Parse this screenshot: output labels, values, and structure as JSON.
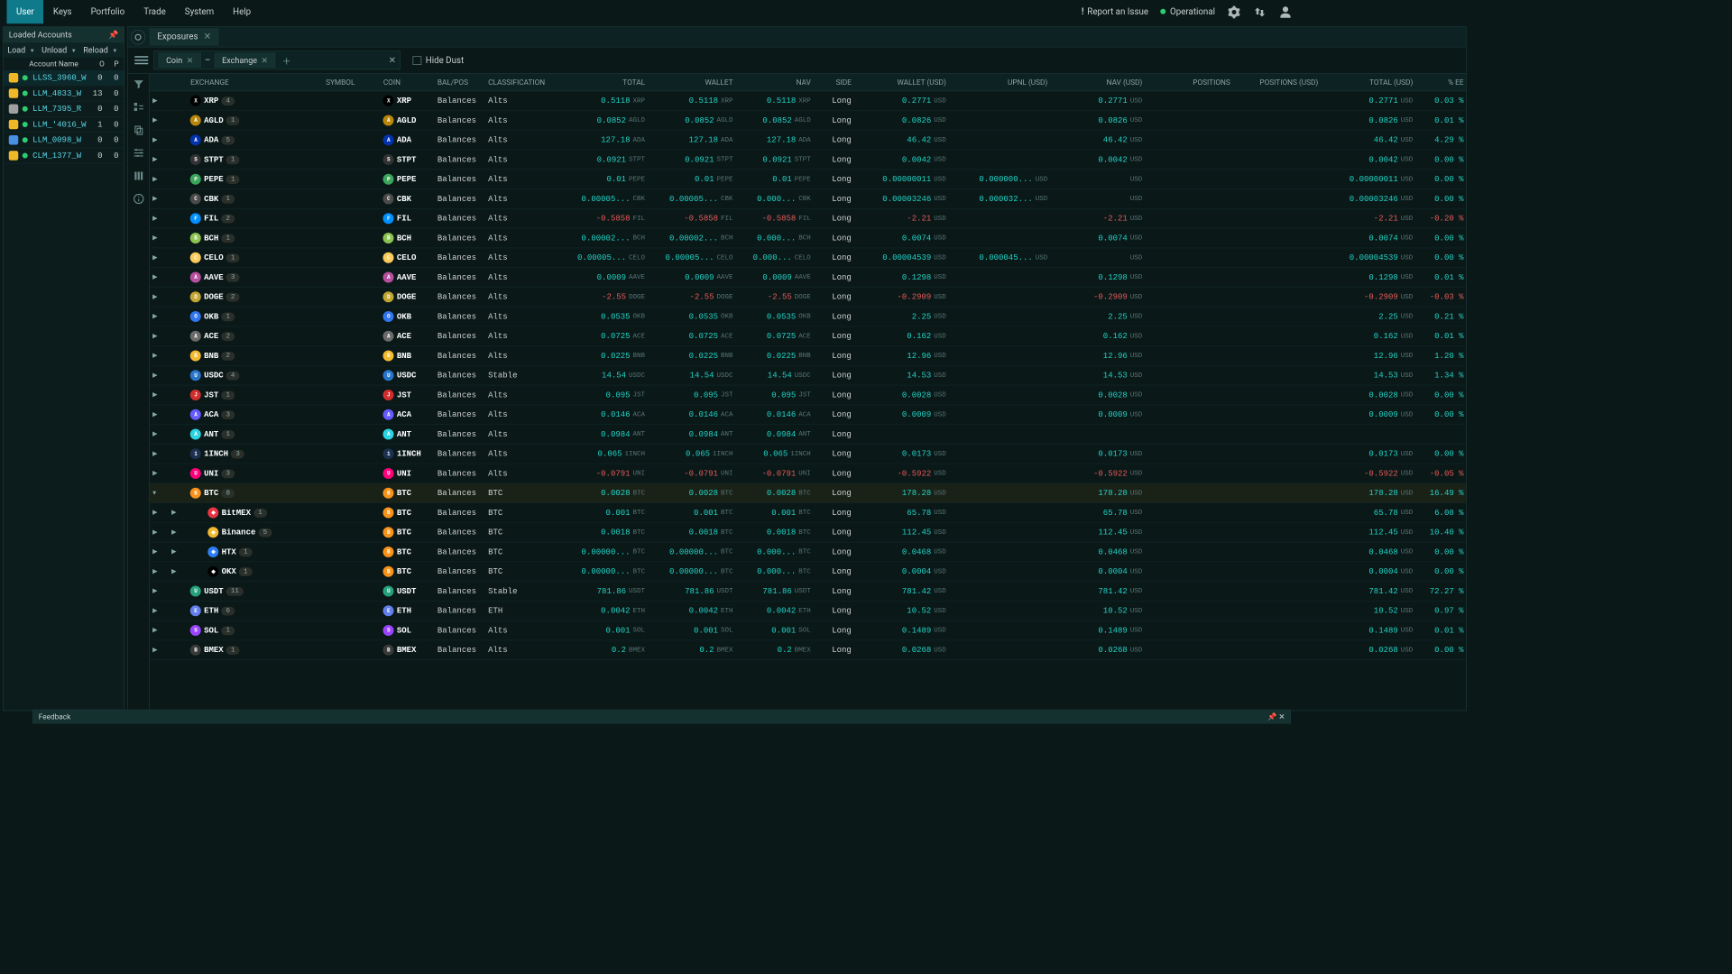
{
  "menu": [
    "User",
    "Keys",
    "Portfolio",
    "Trade",
    "System",
    "Help"
  ],
  "menu_active": 0,
  "header_right": {
    "report": "Report an Issue",
    "status": "Operational"
  },
  "sidebar": {
    "title": "Loaded Accounts",
    "buttons": [
      "Load",
      "Unload",
      "Reload"
    ],
    "columns": {
      "name": "Account Name",
      "o": "O",
      "p": "P"
    },
    "accounts": [
      {
        "name": "LLSS_3960_W",
        "o": 0,
        "p": 0,
        "active": true,
        "color": "#f0b829"
      },
      {
        "name": "LLM_4833_W",
        "o": 13,
        "p": 0,
        "color": "#f0b829"
      },
      {
        "name": "LLM_7395_R",
        "o": 0,
        "p": 0,
        "color": "#a0a0a0"
      },
      {
        "name": "LLM_'4016_W",
        "o": 1,
        "p": 0,
        "color": "#f0b829"
      },
      {
        "name": "LLM_0098_W",
        "o": 0,
        "p": 0,
        "color": "#4a90e2"
      },
      {
        "name": "CLM_1377_W",
        "o": 0,
        "p": 0,
        "color": "#f0b829"
      }
    ]
  },
  "tab": {
    "name": "Exposures"
  },
  "filter": {
    "chips": [
      "Coin",
      "Exchange"
    ],
    "hide_dust": "Hide Dust"
  },
  "columns": [
    "",
    "",
    "EXCHANGE",
    "SYMBOL",
    "COIN",
    "BAL/POS",
    "CLASSIFICATION",
    "TOTAL",
    "WALLET",
    "NAV",
    "SIDE",
    "WALLET (USD)",
    "UPNL (USD)",
    "NAV (USD)",
    "POSITIONS",
    "POSITIONS (USD)",
    "TOTAL (USD)",
    "% EE"
  ],
  "rows": [
    {
      "sym": "XRP",
      "badge": 4,
      "ic": "#000",
      "coin": "XRP",
      "bp": "Balances",
      "cls": "Alts",
      "total": "0.5118",
      "tu": "XRP",
      "wallet": "0.5118",
      "wu": "XRP",
      "nav": "0.5118",
      "nu": "XRP",
      "side": "Long",
      "wusd": "0.2771",
      "uu": "USD",
      "upnl": "",
      "navusd": "0.2771",
      "nuu": "USD",
      "pos": "",
      "posusd": "",
      "tusd": "0.2771",
      "tuu": "USD",
      "ee": "0.03 %"
    },
    {
      "sym": "AGLD",
      "badge": 1,
      "ic": "#b8860b",
      "coin": "AGLD",
      "bp": "Balances",
      "cls": "Alts",
      "total": "0.0852",
      "tu": "AGLD",
      "wallet": "0.0852",
      "wu": "AGLD",
      "nav": "0.0852",
      "nu": "AGLD",
      "side": "Long",
      "wusd": "0.0826",
      "uu": "USD",
      "upnl": "",
      "navusd": "0.0826",
      "nuu": "USD",
      "pos": "",
      "posusd": "",
      "tusd": "0.0826",
      "tuu": "USD",
      "ee": "0.01 %"
    },
    {
      "sym": "ADA",
      "badge": 5,
      "ic": "#0033ad",
      "coin": "ADA",
      "bp": "Balances",
      "cls": "Alts",
      "total": "127.18",
      "tu": "ADA",
      "wallet": "127.18",
      "wu": "ADA",
      "nav": "127.18",
      "nu": "ADA",
      "side": "Long",
      "wusd": "46.42",
      "uu": "USD",
      "upnl": "",
      "navusd": "46.42",
      "nuu": "USD",
      "pos": "",
      "posusd": "",
      "tusd": "46.42",
      "tuu": "USD",
      "ee": "4.29 %"
    },
    {
      "sym": "STPT",
      "badge": 1,
      "ic": "#333",
      "coin": "STPT",
      "bp": "Balances",
      "cls": "Alts",
      "total": "0.0921",
      "tu": "STPT",
      "wallet": "0.0921",
      "wu": "STPT",
      "nav": "0.0921",
      "nu": "STPT",
      "side": "Long",
      "wusd": "0.0042",
      "uu": "USD",
      "upnl": "",
      "navusd": "0.0042",
      "nuu": "USD",
      "pos": "",
      "posusd": "",
      "tusd": "0.0042",
      "tuu": "USD",
      "ee": "0.00 %"
    },
    {
      "sym": "PEPE",
      "badge": 1,
      "ic": "#3ba55c",
      "coin": "PEPE",
      "bp": "Balances",
      "cls": "Alts",
      "total": "0.01",
      "tu": "PEPE",
      "wallet": "0.01",
      "wu": "PEPE",
      "nav": "0.01",
      "nu": "PEPE",
      "side": "Long",
      "wusd": "0.00000011",
      "uu": "USD",
      "upnl": "0.000000...",
      "navusd": "",
      "nuu": "USD",
      "pos": "",
      "posusd": "",
      "tusd": "0.00000011",
      "tuu": "USD",
      "ee": "0.00 %"
    },
    {
      "sym": "CBK",
      "badge": 1,
      "ic": "#4a4a4a",
      "coin": "CBK",
      "bp": "Balances",
      "cls": "Alts",
      "total": "0.00005...",
      "tu": "CBK",
      "wallet": "0.00005...",
      "wu": "CBK",
      "nav": "0.000...",
      "nu": "CBK",
      "side": "Long",
      "wusd": "0.00003246",
      "uu": "USD",
      "upnl": "0.000032...",
      "navusd": "",
      "nuu": "USD",
      "pos": "",
      "posusd": "",
      "tusd": "0.00003246",
      "tuu": "USD",
      "ee": "0.00 %"
    },
    {
      "sym": "FIL",
      "badge": 2,
      "ic": "#0090ff",
      "coin": "FIL",
      "bp": "Balances",
      "cls": "Alts",
      "total": "-0.5858",
      "tneg": true,
      "tu": "FIL",
      "wallet": "-0.5858",
      "wneg": true,
      "wu": "FIL",
      "nav": "-0.5858",
      "nneg": true,
      "nu": "FIL",
      "side": "Long",
      "wusd": "-2.21",
      "wuneg": true,
      "uu": "USD",
      "upnl": "",
      "navusd": "-2.21",
      "nvneg": true,
      "nuu": "USD",
      "pos": "",
      "posusd": "",
      "tusd": "-2.21",
      "tuneg": true,
      "tuu": "USD",
      "ee": "-0.20 %",
      "eeneg": true
    },
    {
      "sym": "BCH",
      "badge": 1,
      "ic": "#8dc351",
      "coin": "BCH",
      "bp": "Balances",
      "cls": "Alts",
      "total": "0.00002...",
      "tu": "BCH",
      "wallet": "0.00002...",
      "wu": "BCH",
      "nav": "0.000...",
      "nu": "BCH",
      "side": "Long",
      "wusd": "0.0074",
      "uu": "USD",
      "upnl": "",
      "navusd": "0.0074",
      "nuu": "USD",
      "pos": "",
      "posusd": "",
      "tusd": "0.0074",
      "tuu": "USD",
      "ee": "0.00 %"
    },
    {
      "sym": "CELO",
      "badge": 1,
      "ic": "#fbcc5c",
      "coin": "CELO",
      "bp": "Balances",
      "cls": "Alts",
      "total": "0.00005...",
      "tu": "CELO",
      "wallet": "0.00005...",
      "wu": "CELO",
      "nav": "0.000...",
      "nu": "CELO",
      "side": "Long",
      "wusd": "0.00004539",
      "uu": "USD",
      "upnl": "0.000045...",
      "navusd": "",
      "nuu": "USD",
      "pos": "",
      "posusd": "",
      "tusd": "0.00004539",
      "tuu": "USD",
      "ee": "0.00 %"
    },
    {
      "sym": "AAVE",
      "badge": 3,
      "ic": "#b6509e",
      "coin": "AAVE",
      "bp": "Balances",
      "cls": "Alts",
      "total": "0.0009",
      "tu": "AAVE",
      "wallet": "0.0009",
      "wu": "AAVE",
      "nav": "0.0009",
      "nu": "AAVE",
      "side": "Long",
      "wusd": "0.1298",
      "uu": "USD",
      "upnl": "",
      "navusd": "0.1298",
      "nuu": "USD",
      "pos": "",
      "posusd": "",
      "tusd": "0.1298",
      "tuu": "USD",
      "ee": "0.01 %"
    },
    {
      "sym": "DOGE",
      "badge": 2,
      "ic": "#c2a633",
      "coin": "DOGE",
      "bp": "Balances",
      "cls": "Alts",
      "total": "-2.55",
      "tneg": true,
      "tu": "DOGE",
      "wallet": "-2.55",
      "wneg": true,
      "wu": "DOGE",
      "nav": "-2.55",
      "nneg": true,
      "nu": "DOGE",
      "side": "Long",
      "wusd": "-0.2909",
      "wuneg": true,
      "uu": "USD",
      "upnl": "",
      "navusd": "-0.2909",
      "nvneg": true,
      "nuu": "USD",
      "pos": "",
      "posusd": "",
      "tusd": "-0.2909",
      "tuneg": true,
      "tuu": "USD",
      "ee": "-0.03 %",
      "eeneg": true
    },
    {
      "sym": "OKB",
      "badge": 1,
      "ic": "#3075ee",
      "coin": "OKB",
      "bp": "Balances",
      "cls": "Alts",
      "total": "0.0535",
      "tu": "OKB",
      "wallet": "0.0535",
      "wu": "OKB",
      "nav": "0.0535",
      "nu": "OKB",
      "side": "Long",
      "wusd": "2.25",
      "uu": "USD",
      "upnl": "",
      "navusd": "2.25",
      "nuu": "USD",
      "pos": "",
      "posusd": "",
      "tusd": "2.25",
      "tuu": "USD",
      "ee": "0.21 %"
    },
    {
      "sym": "ACE",
      "badge": 2,
      "ic": "#6a6a6a",
      "coin": "ACE",
      "bp": "Balances",
      "cls": "Alts",
      "total": "0.0725",
      "tu": "ACE",
      "wallet": "0.0725",
      "wu": "ACE",
      "nav": "0.0725",
      "nu": "ACE",
      "side": "Long",
      "wusd": "0.162",
      "uu": "USD",
      "upnl": "",
      "navusd": "0.162",
      "nuu": "USD",
      "pos": "",
      "posusd": "",
      "tusd": "0.162",
      "tuu": "USD",
      "ee": "0.01 %"
    },
    {
      "sym": "BNB",
      "badge": 2,
      "ic": "#f3ba2f",
      "coin": "BNB",
      "bp": "Balances",
      "cls": "Alts",
      "total": "0.0225",
      "tu": "BNB",
      "wallet": "0.0225",
      "wu": "BNB",
      "nav": "0.0225",
      "nu": "BNB",
      "side": "Long",
      "wusd": "12.96",
      "uu": "USD",
      "upnl": "",
      "navusd": "12.96",
      "nuu": "USD",
      "pos": "",
      "posusd": "",
      "tusd": "12.96",
      "tuu": "USD",
      "ee": "1.20 %"
    },
    {
      "sym": "USDC",
      "badge": 4,
      "ic": "#2775ca",
      "coin": "USDC",
      "bp": "Balances",
      "cls": "Stable",
      "total": "14.54",
      "tu": "USDC",
      "wallet": "14.54",
      "wu": "USDC",
      "nav": "14.54",
      "nu": "USDC",
      "side": "Long",
      "wusd": "14.53",
      "uu": "USD",
      "upnl": "",
      "navusd": "14.53",
      "nuu": "USD",
      "pos": "",
      "posusd": "",
      "tusd": "14.53",
      "tuu": "USD",
      "ee": "1.34 %"
    },
    {
      "sym": "JST",
      "badge": 1,
      "ic": "#d12e2e",
      "coin": "JST",
      "bp": "Balances",
      "cls": "Alts",
      "total": "0.095",
      "tu": "JST",
      "wallet": "0.095",
      "wu": "JST",
      "nav": "0.095",
      "nu": "JST",
      "side": "Long",
      "wusd": "0.0028",
      "uu": "USD",
      "upnl": "",
      "navusd": "0.0028",
      "nuu": "USD",
      "pos": "",
      "posusd": "",
      "tusd": "0.0028",
      "tuu": "USD",
      "ee": "0.00 %"
    },
    {
      "sym": "ACA",
      "badge": 3,
      "ic": "#645aff",
      "coin": "ACA",
      "bp": "Balances",
      "cls": "Alts",
      "total": "0.0146",
      "tu": "ACA",
      "wallet": "0.0146",
      "wu": "ACA",
      "nav": "0.0146",
      "nu": "ACA",
      "side": "Long",
      "wusd": "0.0009",
      "uu": "USD",
      "upnl": "",
      "navusd": "0.0009",
      "nuu": "USD",
      "pos": "",
      "posusd": "",
      "tusd": "0.0009",
      "tuu": "USD",
      "ee": "0.00 %"
    },
    {
      "sym": "ANT",
      "badge": 1,
      "ic": "#2cd3e1",
      "coin": "ANT",
      "bp": "Balances",
      "cls": "Alts",
      "total": "0.0984",
      "tu": "ANT",
      "wallet": "0.0984",
      "wu": "ANT",
      "nav": "0.0984",
      "nu": "ANT",
      "side": "Long",
      "wusd": "",
      "uu": "",
      "upnl": "",
      "navusd": "",
      "nuu": "",
      "pos": "",
      "posusd": "",
      "tusd": "",
      "tuu": "",
      "ee": ""
    },
    {
      "sym": "1INCH",
      "badge": 3,
      "ic": "#1b314f",
      "coin": "1INCH",
      "bp": "Balances",
      "cls": "Alts",
      "total": "0.065",
      "tu": "1INCH",
      "wallet": "0.065",
      "wu": "1INCH",
      "nav": "0.065",
      "nu": "1INCH",
      "side": "Long",
      "wusd": "0.0173",
      "uu": "USD",
      "upnl": "",
      "navusd": "0.0173",
      "nuu": "USD",
      "pos": "",
      "posusd": "",
      "tusd": "0.0173",
      "tuu": "USD",
      "ee": "0.00 %"
    },
    {
      "sym": "UNI",
      "badge": 3,
      "ic": "#ff007a",
      "coin": "UNI",
      "bp": "Balances",
      "cls": "Alts",
      "total": "-0.0791",
      "tneg": true,
      "tu": "UNI",
      "wallet": "-0.0791",
      "wneg": true,
      "wu": "UNI",
      "nav": "-0.0791",
      "nneg": true,
      "nu": "UNI",
      "side": "Long",
      "wusd": "-0.5922",
      "wuneg": true,
      "uu": "USD",
      "upnl": "",
      "navusd": "-0.5922",
      "nvneg": true,
      "nuu": "USD",
      "pos": "",
      "posusd": "",
      "tusd": "-0.5922",
      "tuneg": true,
      "tuu": "USD",
      "ee": "-0.05 %",
      "eeneg": true
    },
    {
      "sym": "BTC",
      "badge": 8,
      "ic": "#f7931a",
      "coin": "BTC",
      "bp": "Balances",
      "cls": "BTC",
      "total": "0.0028",
      "tu": "BTC",
      "wallet": "0.0028",
      "wu": "BTC",
      "nav": "0.0028",
      "nu": "BTC",
      "side": "Long",
      "wusd": "178.28",
      "uu": "USD",
      "upnl": "",
      "navusd": "178.28",
      "nuu": "USD",
      "pos": "",
      "posusd": "",
      "tusd": "178.28",
      "tuu": "USD",
      "ee": "16.49 %",
      "expanded": true
    },
    {
      "sub": true,
      "exch": "BitMEX",
      "exic": "#e83544",
      "badge": 1,
      "ic": "#f7931a",
      "coin": "BTC",
      "bp": "Balances",
      "cls": "BTC",
      "total": "0.001",
      "tu": "BTC",
      "wallet": "0.001",
      "wu": "BTC",
      "nav": "0.001",
      "nu": "BTC",
      "side": "Long",
      "wusd": "65.78",
      "uu": "USD",
      "upnl": "",
      "navusd": "65.78",
      "nuu": "USD",
      "pos": "",
      "posusd": "",
      "tusd": "65.78",
      "tuu": "USD",
      "ee": "6.08 %"
    },
    {
      "sub": true,
      "exch": "Binance",
      "exic": "#f3ba2f",
      "badge": 5,
      "ic": "#f7931a",
      "coin": "BTC",
      "bp": "Balances",
      "cls": "BTC",
      "total": "0.0018",
      "tu": "BTC",
      "wallet": "0.0018",
      "wu": "BTC",
      "nav": "0.0018",
      "nu": "BTC",
      "side": "Long",
      "wusd": "112.45",
      "uu": "USD",
      "upnl": "",
      "navusd": "112.45",
      "nuu": "USD",
      "pos": "",
      "posusd": "",
      "tusd": "112.45",
      "tuu": "USD",
      "ee": "10.40 %"
    },
    {
      "sub": true,
      "exch": "HTX",
      "exic": "#2e7df6",
      "badge": 1,
      "ic": "#f7931a",
      "coin": "BTC",
      "bp": "Balances",
      "cls": "BTC",
      "total": "0.00000...",
      "tu": "BTC",
      "wallet": "0.00000...",
      "wu": "BTC",
      "nav": "0.000...",
      "nu": "BTC",
      "side": "Long",
      "wusd": "0.0468",
      "uu": "USD",
      "upnl": "",
      "navusd": "0.0468",
      "nuu": "USD",
      "pos": "",
      "posusd": "",
      "tusd": "0.0468",
      "tuu": "USD",
      "ee": "0.00 %"
    },
    {
      "sub": true,
      "exch": "OKX",
      "exic": "#000",
      "badge": 1,
      "ic": "#f7931a",
      "coin": "BTC",
      "bp": "Balances",
      "cls": "BTC",
      "total": "0.00000...",
      "tu": "BTC",
      "wallet": "0.00000...",
      "wu": "BTC",
      "nav": "0.000...",
      "nu": "BTC",
      "side": "Long",
      "wusd": "0.0004",
      "uu": "USD",
      "upnl": "",
      "navusd": "0.0004",
      "nuu": "USD",
      "pos": "",
      "posusd": "",
      "tusd": "0.0004",
      "tuu": "USD",
      "ee": "0.00 %"
    },
    {
      "sym": "USDT",
      "badge": 11,
      "ic": "#26a17b",
      "coin": "USDT",
      "bp": "Balances",
      "cls": "Stable",
      "total": "781.86",
      "tu": "USDT",
      "wallet": "781.86",
      "wu": "USDT",
      "nav": "781.86",
      "nu": "USDT",
      "side": "Long",
      "wusd": "781.42",
      "uu": "USD",
      "upnl": "",
      "navusd": "781.42",
      "nuu": "USD",
      "pos": "",
      "posusd": "",
      "tusd": "781.42",
      "tuu": "USD",
      "ee": "72.27 %"
    },
    {
      "sym": "ETH",
      "badge": 6,
      "ic": "#627eea",
      "coin": "ETH",
      "bp": "Balances",
      "cls": "ETH",
      "total": "0.0042",
      "tu": "ETH",
      "wallet": "0.0042",
      "wu": "ETH",
      "nav": "0.0042",
      "nu": "ETH",
      "side": "Long",
      "wusd": "10.52",
      "uu": "USD",
      "upnl": "",
      "navusd": "10.52",
      "nuu": "USD",
      "pos": "",
      "posusd": "",
      "tusd": "10.52",
      "tuu": "USD",
      "ee": "0.97 %"
    },
    {
      "sym": "SOL",
      "badge": 1,
      "ic": "#9945ff",
      "coin": "SOL",
      "bp": "Balances",
      "cls": "Alts",
      "total": "0.001",
      "tu": "SOL",
      "wallet": "0.001",
      "wu": "SOL",
      "nav": "0.001",
      "nu": "SOL",
      "side": "Long",
      "wusd": "0.1489",
      "uu": "USD",
      "upnl": "",
      "navusd": "0.1489",
      "nuu": "USD",
      "pos": "",
      "posusd": "",
      "tusd": "0.1489",
      "tuu": "USD",
      "ee": "0.01 %"
    },
    {
      "sym": "BMEX",
      "badge": 1,
      "ic": "#3a3a3a",
      "coin": "BMEX",
      "bp": "Balances",
      "cls": "Alts",
      "total": "0.2",
      "tu": "BMEX",
      "wallet": "0.2",
      "wu": "BMEX",
      "nav": "0.2",
      "nu": "BMEX",
      "side": "Long",
      "wusd": "0.0268",
      "uu": "USD",
      "upnl": "",
      "navusd": "0.0268",
      "nuu": "USD",
      "pos": "",
      "posusd": "",
      "tusd": "0.0268",
      "tuu": "USD",
      "ee": "0.00 %"
    }
  ],
  "feedback": "Feedback"
}
